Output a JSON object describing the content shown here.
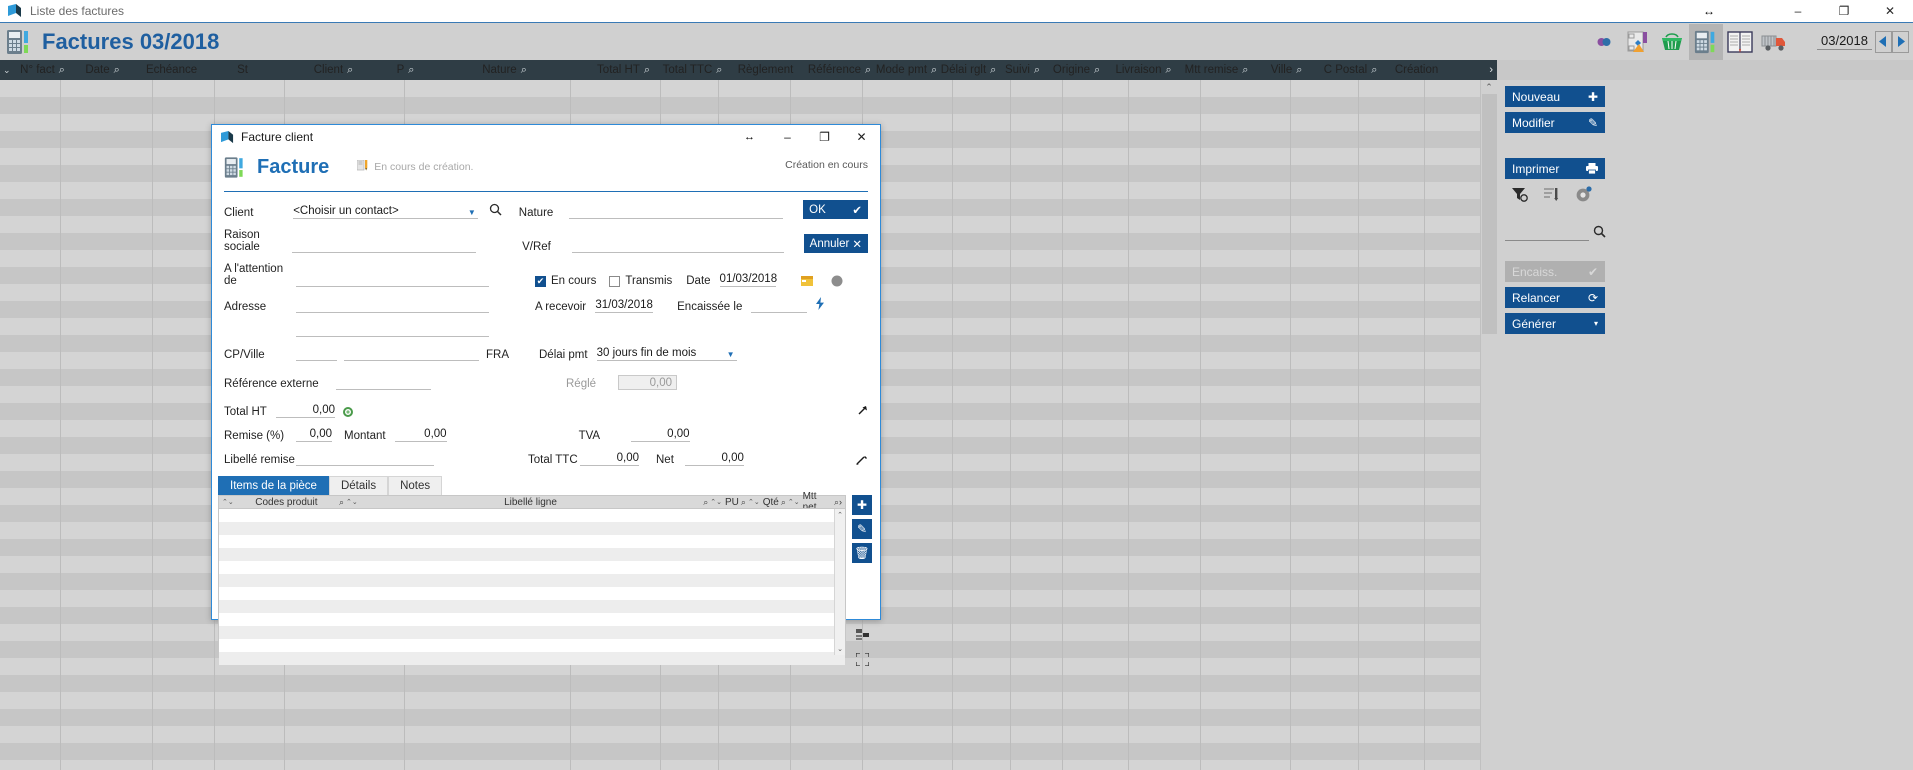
{
  "os_window": {
    "title": "Liste des factures",
    "icon": "app-logo-icon",
    "resize_icon": "resize-horizontal-icon",
    "minimize": "–",
    "maximize": "❐",
    "close": "✕"
  },
  "app_header": {
    "icon": "invoice-terminal-icon",
    "title": "Factures 03/2018",
    "toolbar_icons": [
      {
        "name": "refresh-icon",
        "glyph": "◍"
      },
      {
        "name": "workflow-diagram-icon",
        "glyph": "▤"
      },
      {
        "name": "shopping-basket-icon",
        "glyph": "▥"
      },
      {
        "name": "invoice-terminal-icon",
        "glyph": "▦",
        "selected": true
      },
      {
        "name": "ledger-book-icon",
        "glyph": "▧"
      },
      {
        "name": "delivery-truck-icon",
        "glyph": "▨"
      }
    ],
    "period": "03/2018",
    "prev_arrow": "◀",
    "next_arrow": "▶"
  },
  "columns": [
    {
      "label": "N° fact",
      "search": true,
      "sort": false
    },
    {
      "label": "Date",
      "search": true,
      "sort": false
    },
    {
      "label": "Echéance",
      "search": false,
      "sort": false
    },
    {
      "label": "St",
      "search": false,
      "sort": false
    },
    {
      "label": "Client",
      "search": true,
      "sort": false
    },
    {
      "label": "P",
      "search": true,
      "sort": false
    },
    {
      "label": "Nature",
      "search": true,
      "sort": false
    },
    {
      "label": "Total HT",
      "search": true,
      "sort": false
    },
    {
      "label": "Total TTC",
      "search": true,
      "sort": false
    },
    {
      "label": "Règlement",
      "search": false,
      "sort": false
    },
    {
      "label": "Référence",
      "search": true,
      "sort": false
    },
    {
      "label": "Mode pmt",
      "search": true,
      "sort": false
    },
    {
      "label": "Délai rglt",
      "search": true,
      "sort": false
    },
    {
      "label": "Suivi",
      "search": true,
      "sort": false
    },
    {
      "label": "Origine",
      "search": true,
      "sort": false
    },
    {
      "label": "Livraison",
      "search": true,
      "sort": false
    },
    {
      "label": "Mtt remise",
      "search": true,
      "sort": false
    },
    {
      "label": "Ville",
      "search": true,
      "sort": false
    },
    {
      "label": "C Postal",
      "search": true,
      "sort": false
    },
    {
      "label": "Création",
      "search": false,
      "sort": false
    }
  ],
  "colbar": {
    "collapse_icon": "chevron-down-icon",
    "more_icon": "chevron-right-icon"
  },
  "action_panel": {
    "buttons": [
      {
        "label": "Nouveau",
        "icon": "plus-icon",
        "glyph": "✚",
        "state": "enabled"
      },
      {
        "label": "Modifier",
        "icon": "pencil-icon",
        "glyph": "✎",
        "state": "enabled"
      },
      {
        "label": "Imprimer",
        "icon": "printer-icon",
        "glyph": "🖶",
        "state": "enabled"
      },
      {
        "label": "Encaiss.",
        "icon": "check-icon",
        "glyph": "✔",
        "state": "disabled"
      },
      {
        "label": "Relancer",
        "icon": "refresh-icon",
        "glyph": "⟳",
        "state": "enabled"
      },
      {
        "label": "Générer",
        "icon": "chevron-down-icon",
        "glyph": "▾",
        "state": "enabled"
      }
    ],
    "small_icons": [
      {
        "name": "filter-remove-icon",
        "glyph": "▼"
      },
      {
        "name": "export-list-icon",
        "glyph": "☰"
      },
      {
        "name": "target-icon",
        "glyph": "◉"
      }
    ],
    "search": {
      "value": "",
      "placeholder": "",
      "icon": "search-icon"
    }
  },
  "dialog": {
    "titlebar": {
      "icon": "app-logo-icon",
      "title": "Facture client",
      "resize_icon": "resize-horizontal-icon",
      "minimize": "–",
      "maximize": "❐",
      "close": "✕"
    },
    "header": {
      "icon": "invoice-terminal-icon",
      "title": "Facture",
      "status_icon": "pencil-document-icon",
      "status_text": "En cours de création.",
      "creation_note": "Création en cours"
    },
    "fields": {
      "client_label": "Client",
      "client_value": "<Choisir un contact>",
      "client_search_icon": "search-icon",
      "client_caret_icon": "chevron-down-icon",
      "raison_sociale_label": "Raison sociale",
      "raison_sociale_value": "",
      "attention_label": "A l'attention de",
      "attention_value": "",
      "adresse_label": "Adresse",
      "adresse_value": "",
      "adresse_line2_value": "",
      "cp_ville_label": "CP/Ville",
      "cp_value": "",
      "ville_value": "",
      "pays_value": "FRA",
      "reference_externe_label": "Référence externe",
      "reference_externe_value": "",
      "remise_label": "Remise (%)",
      "remise_value": "0,00",
      "montant_label": "Montant",
      "montant_value": "0,00",
      "libelle_remise_label": "Libellé remise",
      "libelle_remise_value": "",
      "nature_label": "Nature",
      "nature_value": "",
      "vref_label": "V/Ref",
      "vref_value": "",
      "en_cours_label": "En cours",
      "en_cours_checked": true,
      "transmis_label": "Transmis",
      "transmis_checked": false,
      "date_label": "Date",
      "date_value": "01/03/2018",
      "a_recevoir_label": "A recevoir",
      "a_recevoir_value": "31/03/2018",
      "encaissee_le_label": "Encaissée le",
      "encaissee_le_value": "",
      "delai_pmt_label": "Délai pmt",
      "delai_pmt_value": "30 jours fin de mois",
      "delai_pmt_caret_icon": "chevron-down-icon",
      "regle_label": "Réglé",
      "regle_value": "0,00",
      "total_ht_label": "Total HT",
      "total_ht_value": "0,00",
      "total_ht_icon": "recalculate-icon",
      "tva_label": "TVA",
      "tva_value": "0,00",
      "total_ttc_label": "Total TTC",
      "total_ttc_value": "0,00",
      "net_label": "Net",
      "net_value": "0,00",
      "calendar_icon": "calendar-icon",
      "circle_icon": "status-circle-icon",
      "lightning_icon": "lightning-icon",
      "expand_up_icon": "expand-up-icon",
      "edit_pencil_icon": "pencil-icon"
    },
    "buttons": {
      "ok_label": "OK",
      "ok_icon": "check-icon",
      "cancel_label": "Annuler",
      "cancel_icon": "close-icon"
    },
    "tabs": [
      {
        "label": "Items de la pièce",
        "active": true
      },
      {
        "label": "Détails",
        "active": false
      },
      {
        "label": "Notes",
        "active": false
      }
    ],
    "line_grid": {
      "columns": [
        "Codes produit",
        "Libellé ligne",
        "PU",
        "Qté",
        "Mtt net"
      ],
      "rows": [],
      "more_icon": "chevron-right-icon",
      "scroll_up_icon": "chevron-up-icon",
      "scroll_down_icon": "chevron-down-icon"
    },
    "line_buttons": [
      {
        "name": "add-line-button",
        "glyph": "✚"
      },
      {
        "name": "edit-line-button",
        "glyph": "✎"
      },
      {
        "name": "delete-line-button",
        "glyph": "🗑"
      },
      {
        "name": "reorder-lines-button",
        "glyph": "⇄"
      },
      {
        "name": "fullscreen-button",
        "glyph": "⛶"
      }
    ]
  }
}
